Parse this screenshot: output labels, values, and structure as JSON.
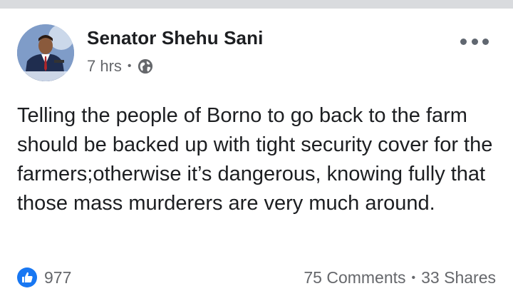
{
  "post": {
    "author": "Senator Shehu Sani",
    "time": "7 hrs",
    "separator": "•",
    "privacy_icon": "globe-icon",
    "text": "Telling the people of Borno to go back to the farm should be backed up with tight security cover for the farmers;otherwise it’s dangerous, knowing fully that those mass murderers are very much around."
  },
  "footer": {
    "like_icon": "like-icon",
    "like_count": "977",
    "comments": "75 Comments",
    "separator": "•",
    "shares": "33 Shares"
  },
  "colors": {
    "like_blue": "#1877f2",
    "meta_gray": "#65676b",
    "text": "#1c1e21"
  }
}
